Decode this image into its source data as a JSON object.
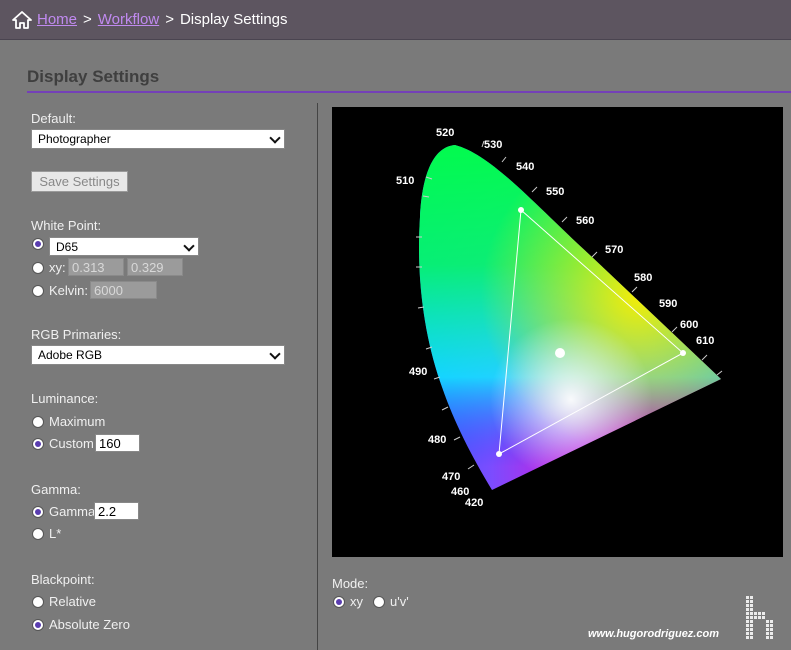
{
  "breadcrumb": {
    "home": "Home",
    "separator": ">",
    "workflow": "Workflow",
    "current": "Display Settings"
  },
  "page": {
    "title": "Display Settings"
  },
  "form": {
    "default_label": "Default:",
    "default_value": "Photographer",
    "save_label": "Save Settings",
    "white_point": {
      "label": "White Point:",
      "selected": "preset",
      "preset_value": "D65",
      "xy_label": "xy:",
      "xy_x": "0.313",
      "xy_y": "0.329",
      "kelvin_label": "Kelvin:",
      "kelvin_value": "6000"
    },
    "rgb_primaries": {
      "label": "RGB Primaries:",
      "value": "Adobe RGB"
    },
    "luminance": {
      "label": "Luminance:",
      "maximum_label": "Maximum",
      "custom_label": "Custom",
      "custom_value": "160",
      "selected": "custom"
    },
    "gamma": {
      "label": "Gamma:",
      "gamma_label": "Gamma",
      "gamma_value": "2.2",
      "lstar_label": "L*",
      "selected": "gamma"
    },
    "blackpoint": {
      "label": "Blackpoint:",
      "relative_label": "Relative",
      "absolute_label": "Absolute Zero",
      "selected": "absolute"
    }
  },
  "mode": {
    "label": "Mode:",
    "xy_label": "xy",
    "uv_label": "u'v'",
    "selected": "xy"
  },
  "diagram": {
    "wavelength_labels": [
      "520",
      "530",
      "540",
      "550",
      "560",
      "570",
      "580",
      "590",
      "600",
      "610",
      "510",
      "490",
      "480",
      "470",
      "460",
      "420"
    ]
  },
  "watermark": {
    "text": "www.hugorodriguez.com"
  },
  "colors": {
    "accent": "#7440b8",
    "link": "#c08af0",
    "topbar": "#5d5560",
    "background": "#7a7a7a"
  }
}
